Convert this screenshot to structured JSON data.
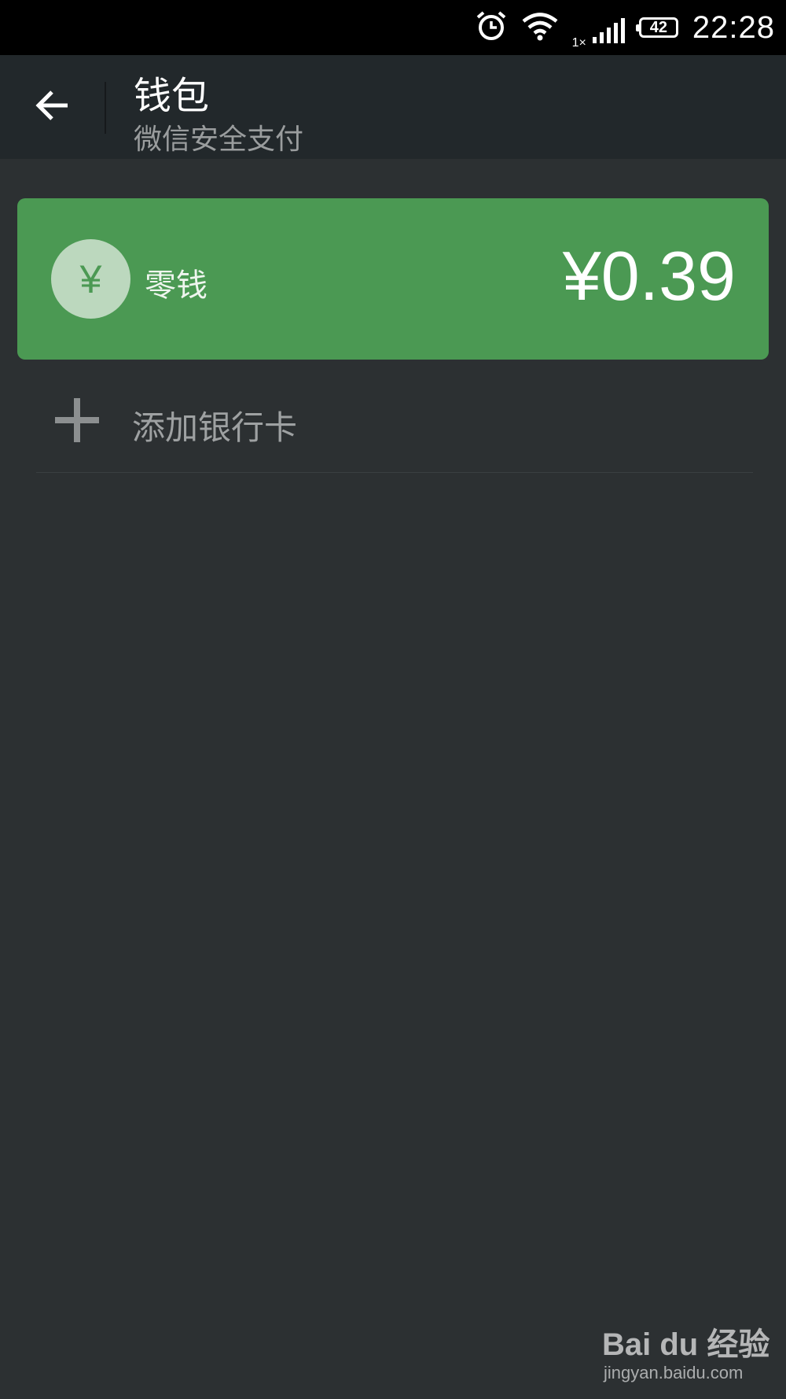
{
  "status_bar": {
    "time": "22:28",
    "battery_level": "42",
    "network_type": "1×",
    "icons": [
      "alarm-icon",
      "wifi-icon",
      "signal-icon",
      "battery-icon"
    ]
  },
  "header": {
    "title": "钱包",
    "subtitle": "微信安全支付",
    "back_icon": "arrow-left-icon"
  },
  "balance_card": {
    "icon_symbol": "¥",
    "label": "零钱",
    "amount": "¥0.39",
    "background_color": "#4b9953"
  },
  "add_bank_card": {
    "label": "添加银行卡",
    "icon": "plus-icon"
  },
  "watermark": {
    "brand": "Bai du 经验",
    "url": "jingyan.baidu.com"
  }
}
